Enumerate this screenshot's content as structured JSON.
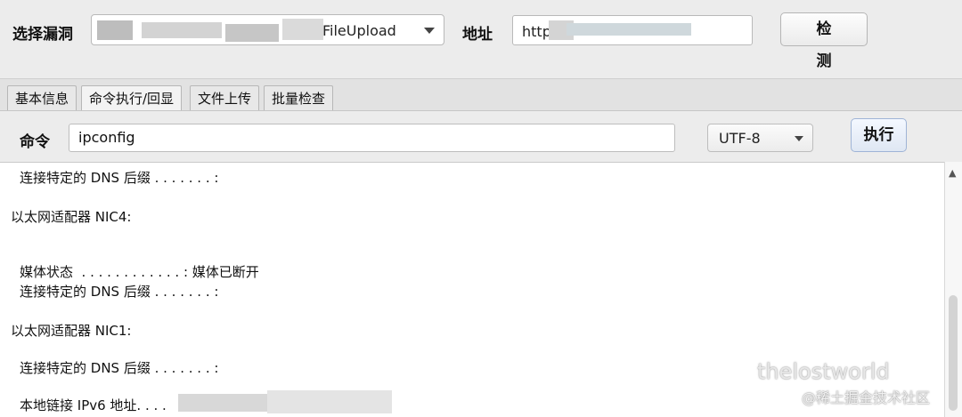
{
  "header": {
    "vuln_label": "选择漏洞",
    "vuln_selected": "FileUpload",
    "addr_label": "地址",
    "addr_value": "http",
    "detect_label": "检测"
  },
  "tabs": [
    {
      "label": "基本信息",
      "active": false
    },
    {
      "label": "命令执行/回显",
      "active": true
    },
    {
      "label": "文件上传",
      "active": false
    },
    {
      "label": "批量检查",
      "active": false
    }
  ],
  "command": {
    "label": "命令",
    "value": "ipconfig",
    "encoding": "UTF-8",
    "exec_label": "执行"
  },
  "output_lines": [
    "连接特定的 DNS 后缀 . . . . . . . :",
    "以太网适配器 NIC4:",
    "媒体状态  . . . . . . . . . . . . : 媒体已断开",
    "连接特定的 DNS 后缀 . . . . . . . :",
    "以太网适配器 NIC1:",
    "连接特定的 DNS 后缀 . . . . . . . :",
    "本地链接 IPv6 地址. . . ."
  ],
  "watermark": {
    "title": "thelostworld",
    "sub": "@稀土掘金技术社区"
  },
  "icons": {
    "dropdown": "chevron-down-icon",
    "scroll_up": "scroll-up-arrow-icon"
  }
}
